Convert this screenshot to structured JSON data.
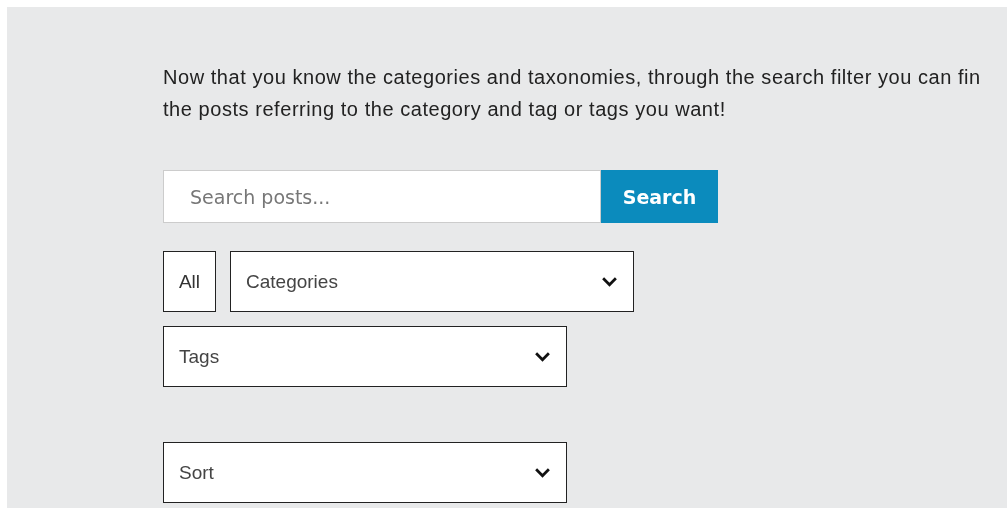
{
  "intro": "Now that you know the categories and taxonomies, through the search filter you can fin\nthe posts referring to the category and tag or tags you want!",
  "search": {
    "placeholder": "Search posts...",
    "button": "Search"
  },
  "filters": [
    {
      "kind": "button",
      "label": "All"
    },
    {
      "kind": "select",
      "label": "Categories"
    },
    {
      "kind": "break"
    },
    {
      "kind": "select",
      "label": "Tags"
    },
    {
      "kind": "gap"
    },
    {
      "kind": "select",
      "label": "Sort"
    }
  ]
}
